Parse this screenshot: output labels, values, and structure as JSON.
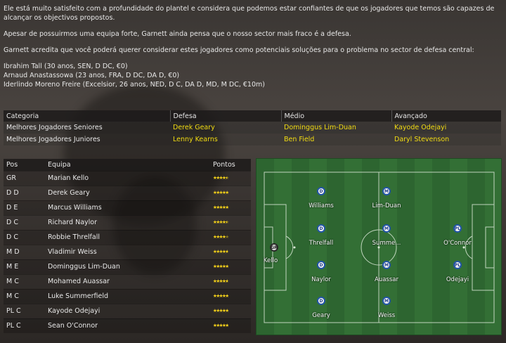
{
  "intro": {
    "line1": "Ele está muito satisfeito com a profundidade do plantel e considera que podemos estar confiantes de que os jogadores que temos são capazes de alcançar os objectivos propostos.",
    "line2": "Apesar de possuirmos uma equipa forte, Garnett ainda pensa que o nosso sector mais fraco é a defesa.",
    "line3": "Garnett acredita que você poderá querer considerar estes jogadores como potenciais soluções para o problema no sector de defesa central:",
    "players": [
      "Ibrahim Tall (30 anos, SEN, D DC, €0)",
      "Arnaud Anastassowa (23 anos, FRA, D DC, DA D, €0)",
      "Iderlindo Moreno Freire (Excelsior, 26 anos, NED, D C, DA D, MD, M DC, €10m)"
    ]
  },
  "categories": {
    "headers": [
      "Categoria",
      "Defesa",
      "Médio",
      "Avançado"
    ],
    "rows": [
      [
        "Melhores Jogadores Seniores",
        "Derek Geary",
        "Dominggus Lim-Duan",
        "Kayode Odejayi"
      ],
      [
        "Melhores Jogadores Juniores",
        "Lenny Kearns",
        "Ben Field",
        "Daryl Stevenson"
      ]
    ]
  },
  "lineup": {
    "headers": [
      "Pos",
      "Equipa",
      "Pontos"
    ],
    "rows": [
      {
        "pos": "GR",
        "name": "Marian Kello",
        "rating": 0.75
      },
      {
        "pos": "D D",
        "name": "Derek Geary",
        "rating": 1.0
      },
      {
        "pos": "D E",
        "name": "Marcus Williams",
        "rating": 0.85
      },
      {
        "pos": "D C",
        "name": "Richard Naylor",
        "rating": 0.75
      },
      {
        "pos": "D C",
        "name": "Robbie Threlfall",
        "rating": 0.7
      },
      {
        "pos": "M D",
        "name": "Vladimir Weiss",
        "rating": 0.8
      },
      {
        "pos": "M E",
        "name": "Dominggus Lim-Duan",
        "rating": 0.85
      },
      {
        "pos": "M C",
        "name": "Mohamed Auassar",
        "rating": 0.8
      },
      {
        "pos": "M C",
        "name": "Luke Summerfield",
        "rating": 0.85
      },
      {
        "pos": "PL C",
        "name": "Kayode Odejayi",
        "rating": 0.85
      },
      {
        "pos": "PL C",
        "name": "Sean O'Connor",
        "rating": 0.85
      }
    ]
  },
  "pitch": {
    "players": [
      {
        "badge": "GR",
        "label": "Kello",
        "gk": true
      },
      {
        "badge": "D",
        "label": "Williams"
      },
      {
        "badge": "D",
        "label": "Threlfall"
      },
      {
        "badge": "D",
        "label": "Naylor"
      },
      {
        "badge": "D",
        "label": "Geary"
      },
      {
        "badge": "M",
        "label": "Lim-Duan"
      },
      {
        "badge": "M",
        "label": "Summe..."
      },
      {
        "badge": "M",
        "label": "Auassar"
      },
      {
        "badge": "M",
        "label": "Weiss"
      },
      {
        "badge": "PL",
        "label": "O'Connor"
      },
      {
        "badge": "PL",
        "label": "Odejayi"
      }
    ]
  },
  "colors": {
    "highlight": "#f2dc12",
    "star": "#f5d21a",
    "pitch": "#2f6a32",
    "player_ring": "#2255a8"
  }
}
